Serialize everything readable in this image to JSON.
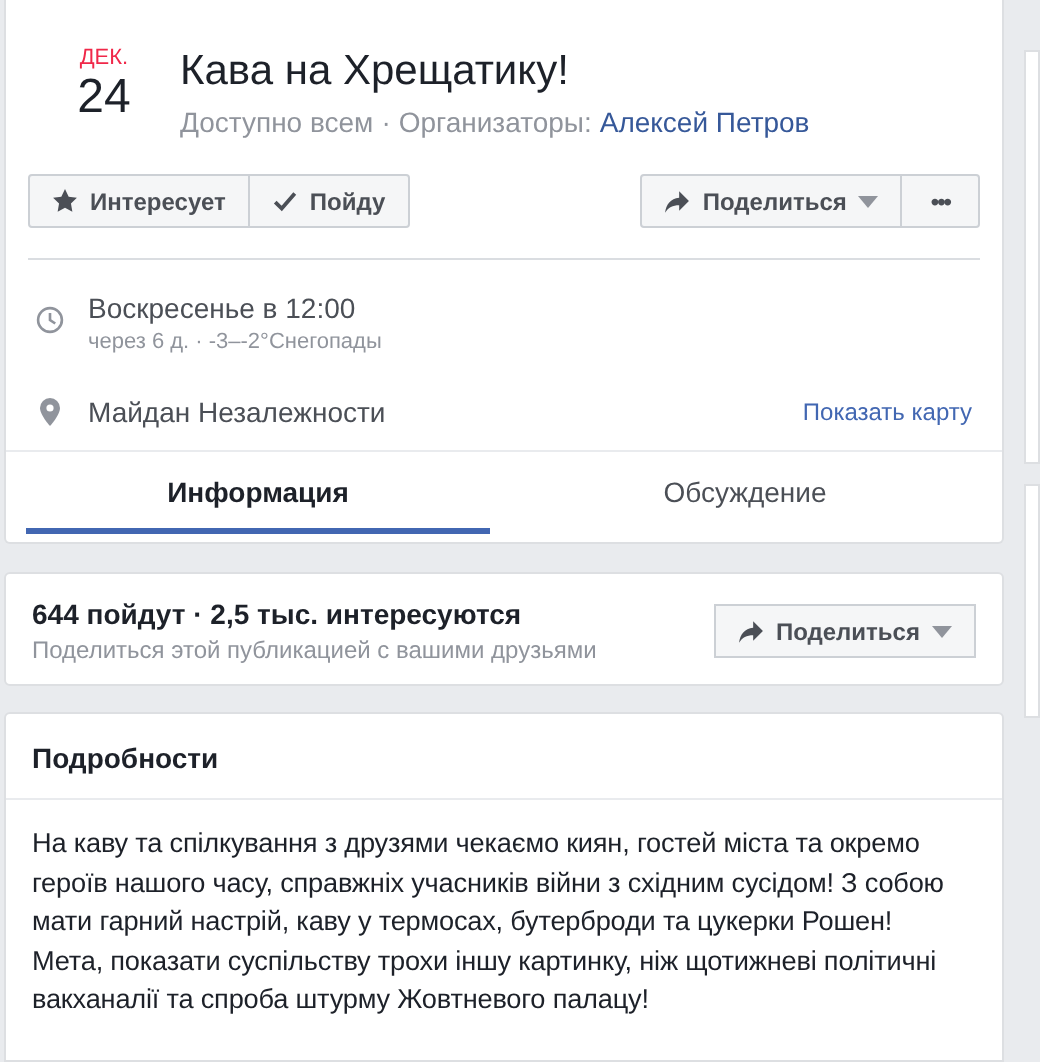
{
  "event": {
    "month": "ДЕК.",
    "day": "24",
    "title": "Кава на Хрещатику!",
    "privacy": "Доступно всем",
    "separator": "·",
    "organizers_label": "Организаторы:",
    "organizer": "Алексей Петров"
  },
  "actions": [
    {
      "label": "Интересует",
      "kind": "interested"
    },
    {
      "label": "Пойду",
      "kind": "going"
    }
  ],
  "share": {
    "label": "Поделиться",
    "more": "•••"
  },
  "time": {
    "main": "Воскресенье в 12:00",
    "sub": "через 6 д. · -3–-2°Снегопады"
  },
  "location": {
    "name": "Майдан Незалежности",
    "map_link": "Показать карту"
  },
  "tabs": [
    {
      "label": "Информация",
      "selected": true
    },
    {
      "label": "Обсуждение",
      "selected": false
    }
  ],
  "stats": {
    "summary": "644 пойдут · 2,5 тыс. интересуются",
    "hint": "Поделиться этой публикацией с вашими друзьями",
    "share": "Поделиться"
  },
  "details": {
    "title": "Подробности",
    "paragraphs": [
      "На каву та спілкування з друзями чекаємо киян, гостей міста та окремо героїв нашого часу, справжніх учасників війни з східним сусідом! З собою мати гарний настрій, каву у термосах, бутерброди та цукерки Рошен!",
      "Мета, показати суспільству трохи іншу картинку, ніж щотижневі політичні вакханалії та спроба штурму Жовтневого палацу!"
    ]
  }
}
